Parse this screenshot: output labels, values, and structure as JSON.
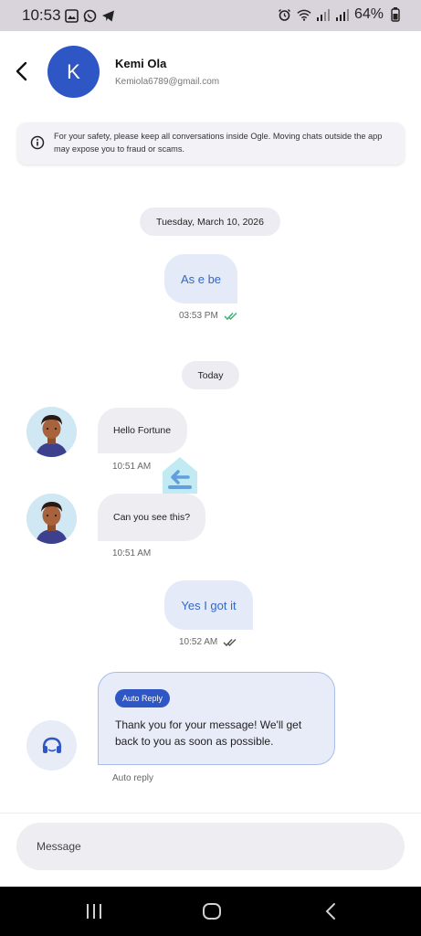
{
  "status_bar": {
    "time": "10:53",
    "battery": "64%",
    "icons": [
      "gallery-icon",
      "whatsapp-icon",
      "telegram-icon",
      "alarm-icon",
      "wifi-icon",
      "signal-icon",
      "signal-icon",
      "battery-icon"
    ]
  },
  "header": {
    "avatar_initial": "K",
    "name": "Kemi Ola",
    "email": "Kemiola6789@gmail.com"
  },
  "notice": {
    "text": "For your safety, please keep all conversations inside Ogle. Moving chats outside the app may expose you to fraud or scams."
  },
  "messages": {
    "date_1": "Tuesday, March 10, 2026",
    "out_1": {
      "text": "As e be",
      "time": "03:53 PM",
      "status": "read"
    },
    "date_2": "Today",
    "in_1": {
      "text": "Hello Fortune",
      "time": "10:51 AM"
    },
    "in_2": {
      "text": "Can you see this?",
      "time": "10:51 AM"
    },
    "out_2": {
      "text": "Yes I got it",
      "time": "10:52 AM",
      "status": "delivered"
    },
    "auto_reply": {
      "badge": "Auto Reply",
      "text": "Thank you for your message! We'll get back to you as soon as possible.",
      "caption": "Auto reply"
    }
  },
  "composer": {
    "placeholder": "Message"
  },
  "colors": {
    "accent": "#2f56c5",
    "read_tick": "#3bb273",
    "outgoing_bubble": "#e5eaf8",
    "incoming_bubble": "#ededf2"
  }
}
